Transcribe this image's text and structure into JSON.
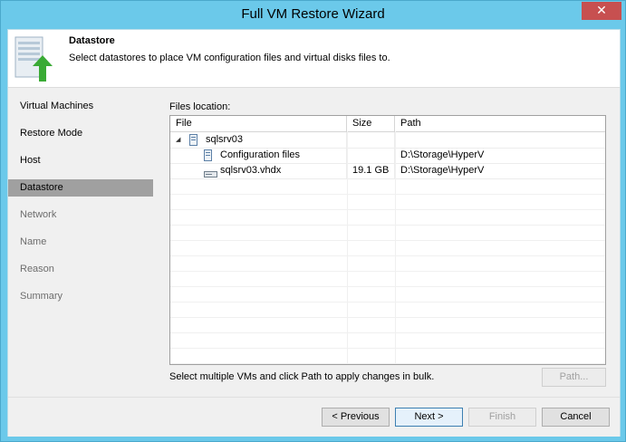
{
  "window": {
    "title": "Full VM Restore Wizard",
    "close_glyph": "✕"
  },
  "header": {
    "icon": "server-restore-icon",
    "title": "Datastore",
    "description": "Select datastores to place VM configuration files and virtual disks files to."
  },
  "steps": [
    {
      "label": "Virtual Machines",
      "state": "done"
    },
    {
      "label": "Restore Mode",
      "state": "done"
    },
    {
      "label": "Host",
      "state": "done"
    },
    {
      "label": "Datastore",
      "state": "active"
    },
    {
      "label": "Network",
      "state": "disabled"
    },
    {
      "label": "Name",
      "state": "disabled"
    },
    {
      "label": "Reason",
      "state": "disabled"
    },
    {
      "label": "Summary",
      "state": "disabled"
    }
  ],
  "files": {
    "label": "Files location:",
    "columns": [
      "File",
      "Size",
      "Path"
    ],
    "rows": [
      {
        "name": "sqlsrv03",
        "size": "",
        "path": "",
        "icon": "vm-icon",
        "expander": "◢"
      },
      {
        "name": "Configuration files",
        "size": "",
        "path": "D:\\Storage\\HyperV",
        "icon": "file-icon"
      },
      {
        "name": "sqlsrv03.vhdx",
        "size": "19.1 GB",
        "path": "D:\\Storage\\HyperV",
        "icon": "disk-icon"
      }
    ]
  },
  "hint": "Select multiple VMs and click Path to apply changes in bulk.",
  "buttons": {
    "path": "Path...",
    "previous": "< Previous",
    "next": "Next >",
    "finish": "Finish",
    "cancel": "Cancel"
  },
  "colors": {
    "titlebar": "#6bc9ea",
    "close": "#c75050",
    "active_step": "#a0a0a0",
    "accent_green": "#3aaa35"
  }
}
